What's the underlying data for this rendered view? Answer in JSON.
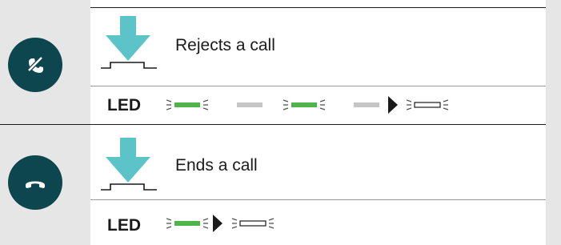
{
  "rows": [
    {
      "action": "Rejects a call",
      "button_icon": "reject-call-icon",
      "led_label": "LED",
      "led_sequence": [
        "green-blink",
        "grey-solid",
        "green-blink",
        "grey-solid",
        "arrow",
        "white-blink"
      ]
    },
    {
      "action": "Ends a call",
      "button_icon": "end-call-icon",
      "led_label": "LED",
      "led_sequence": [
        "green-blink",
        "arrow",
        "white-blink"
      ]
    }
  ],
  "colors": {
    "icon_circle": "#0e4650",
    "press_arrow": "#5cc4c9",
    "led_green": "#4fb54a",
    "led_grey": "#c5c5c5",
    "background_side": "#e6e6e7"
  }
}
